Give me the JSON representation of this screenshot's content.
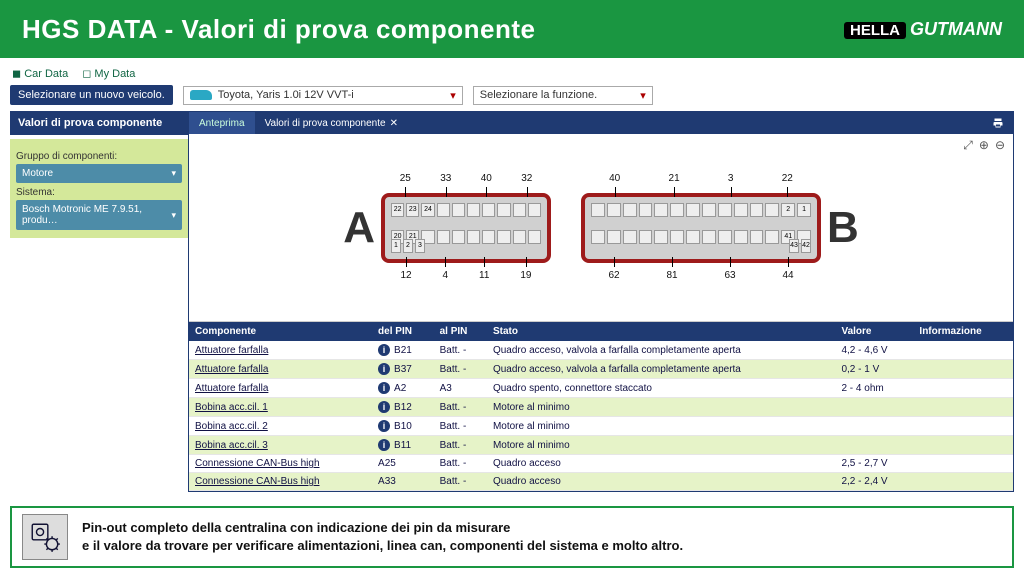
{
  "banner": {
    "title": "HGS DATA - Valori di prova componente",
    "brand_prefix": "HELLA",
    "brand_main": "GUTMANN"
  },
  "nav": {
    "car_data": "Car Data",
    "my_data": "My Data"
  },
  "vehicle_bar": {
    "select_new": "Selezionare un nuovo veicolo.",
    "vehicle": "Toyota, Yaris 1.0i 12V VVT-i",
    "function_placeholder": "Selezionare la funzione."
  },
  "side": {
    "title": "Valori di prova componente",
    "group_label": "Gruppo di componenti:",
    "group_value": "Motore",
    "system_label": "Sistema:",
    "system_value": "Bosch Motronic ME 7.9.51, produ…"
  },
  "content_tabs": {
    "preview": "Anteprima",
    "main": "Valori di prova componente"
  },
  "connectors": {
    "a": {
      "letter": "A",
      "top": [
        "25",
        "33",
        "40",
        "32"
      ],
      "bottom": [
        "12",
        "4",
        "11",
        "19"
      ],
      "visible_pins": [
        "22",
        "23",
        "24",
        "20",
        "21",
        "1",
        "2",
        "3"
      ]
    },
    "b": {
      "letter": "B",
      "top": [
        "40",
        "21",
        "3",
        "22"
      ],
      "bottom": [
        "62",
        "81",
        "63",
        "44"
      ],
      "visible_pins": [
        "2",
        "1",
        "41",
        "43",
        "42"
      ]
    }
  },
  "table": {
    "headers": {
      "component": "Componente",
      "from_pin": "del PIN",
      "to_pin": "al PIN",
      "state": "Stato",
      "value": "Valore",
      "info": "Informazione"
    },
    "rows": [
      {
        "component": "Attuatore farfalla",
        "from": "B21",
        "to": "Batt. -",
        "state": "Quadro acceso, valvola a farfalla completamente aperta",
        "value": "4,2 - 4,6 V",
        "info_icon": true
      },
      {
        "component": "Attuatore farfalla",
        "from": "B37",
        "to": "Batt. -",
        "state": "Quadro acceso, valvola a farfalla completamente aperta",
        "value": "0,2 - 1 V",
        "info_icon": true
      },
      {
        "component": "Attuatore farfalla",
        "from": "A2",
        "to": "A3",
        "state": "Quadro spento, connettore staccato",
        "value": "2 - 4 ohm",
        "info_icon": true
      },
      {
        "component": "Bobina acc.cil. 1",
        "from": "B12",
        "to": "Batt. -",
        "state": "Motore al minimo",
        "value": "",
        "info_icon": true
      },
      {
        "component": "Bobina acc.cil. 2",
        "from": "B10",
        "to": "Batt. -",
        "state": "Motore al minimo",
        "value": "",
        "info_icon": true
      },
      {
        "component": "Bobina acc.cil. 3",
        "from": "B11",
        "to": "Batt. -",
        "state": "Motore al minimo",
        "value": "",
        "info_icon": true
      },
      {
        "component": "Connessione CAN-Bus high",
        "from": "A25",
        "to": "Batt. -",
        "state": "Quadro acceso",
        "value": "2,5 - 2,7 V",
        "info_icon": false
      },
      {
        "component": "Connessione CAN-Bus high",
        "from": "A33",
        "to": "Batt. -",
        "state": "Quadro acceso",
        "value": "2,2 - 2,4 V",
        "info_icon": false
      }
    ]
  },
  "footer": {
    "line1": "Pin-out completo della centralina con indicazione dei pin da misurare",
    "line2": "e il valore da trovare per verificare alimentazioni, linea can, componenti del sistema e molto altro."
  }
}
